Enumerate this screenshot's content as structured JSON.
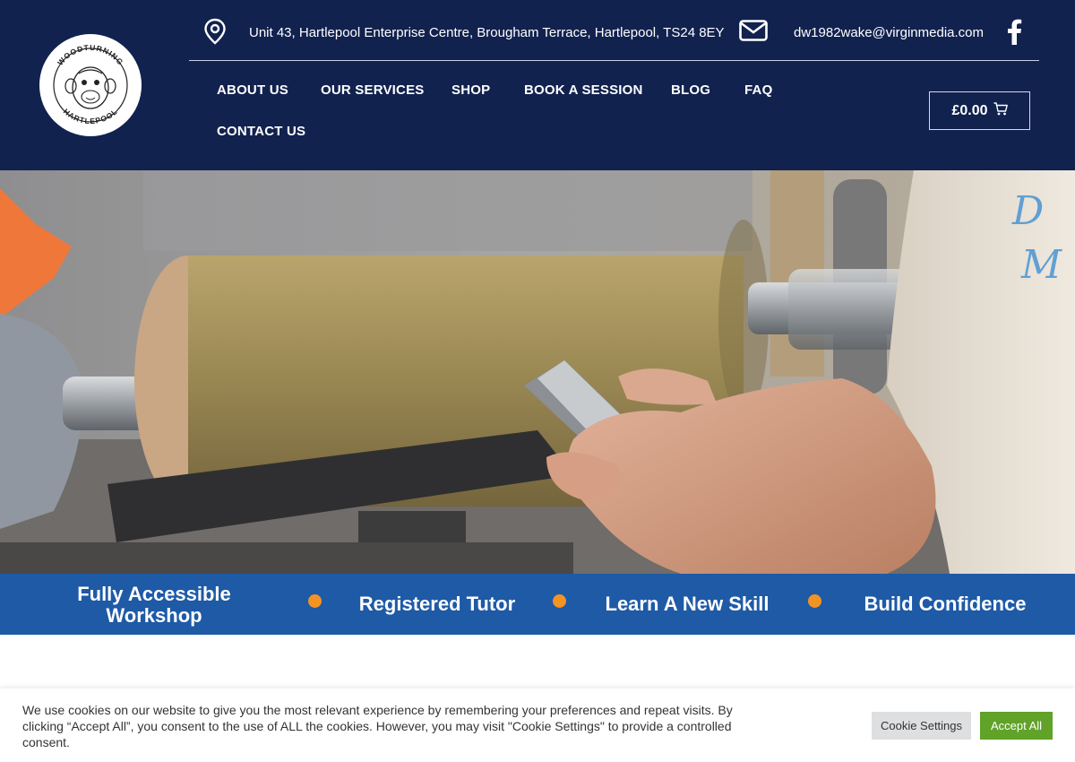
{
  "brand": {
    "logo_top": "WOODTURNING",
    "logo_bottom": "HARTLEPOOL"
  },
  "contact": {
    "address": "Unit 43, Hartlepool Enterprise Centre, Brougham Terrace, Hartlepool, TS24 8EY",
    "email": "dw1982wake@virginmedia.com"
  },
  "nav": {
    "items": [
      "ABOUT US",
      "OUR SERVICES",
      "SHOP",
      "BOOK A SESSION",
      "BLOG",
      "FAQ",
      "CONTACT US"
    ]
  },
  "cart": {
    "total": "£0.00"
  },
  "features": {
    "items": [
      {
        "line1": "Fully Accessible",
        "line2": "Workshop"
      },
      {
        "line1": "Registered Tutor"
      },
      {
        "line1": "Learn A New Skill"
      },
      {
        "line1": "Build Confidence"
      }
    ]
  },
  "cookie": {
    "text": "We use cookies on our website to give you the most relevant experience by remembering your preferences and repeat visits. By clicking “Accept All”, you consent to the use of ALL the cookies. However, you may visit \"Cookie Settings\" to provide a controlled consent.",
    "settings_label": "Cookie Settings",
    "accept_label": "Accept All"
  },
  "colors": {
    "header_bg": "#12224f",
    "feature_band": "#1e5aa6",
    "feature_dot": "#f39322",
    "accept_button": "#61a229"
  },
  "icons": [
    "map-pin-icon",
    "envelope-icon",
    "facebook-icon",
    "cart-icon"
  ]
}
